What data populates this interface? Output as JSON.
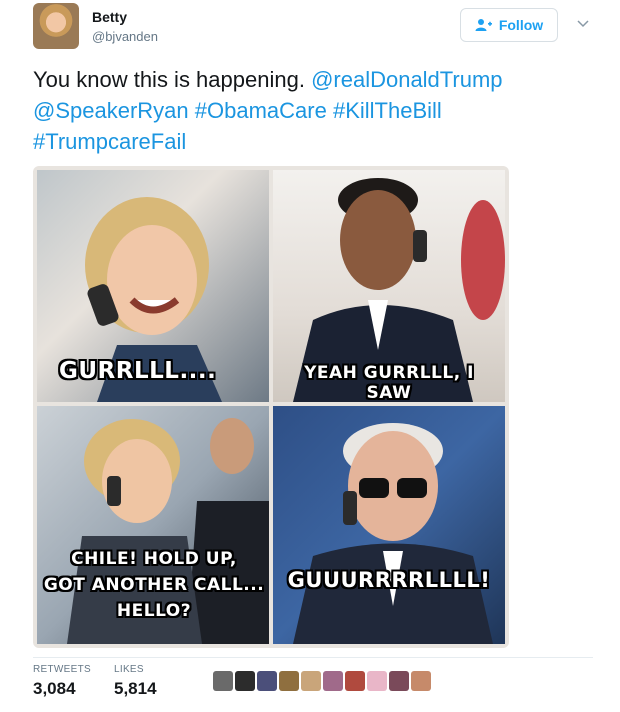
{
  "user": {
    "name": "Betty",
    "handle": "@bjvanden"
  },
  "follow_button": {
    "label": "Follow",
    "icon": "follow-person-plus-icon"
  },
  "tweet": {
    "text_plain": "You know this is happening. ",
    "mentions": [
      "@realDonaldTrump",
      "@SpeakerRyan"
    ],
    "hashtags": [
      "#ObamaCare",
      "#KillTheBill",
      "#TrumpcareFail"
    ]
  },
  "meme": {
    "panel1": "GURRLLL....",
    "panel2": "YEAH GURRLLL, I SAW",
    "panel3_line1": "CHILE! HOLD UP,",
    "panel3_line2": "GOT ANOTHER CALL...",
    "panel3_line3": "HELLO?",
    "panel4": "GUUURRRRLLLL!"
  },
  "stats": {
    "retweets_label": "RETWEETS",
    "retweets_value": "3,084",
    "likes_label": "LIKES",
    "likes_value": "5,814"
  },
  "colors": {
    "link": "#1b95e0",
    "follow": "#1da1f2",
    "muted": "#657786"
  }
}
